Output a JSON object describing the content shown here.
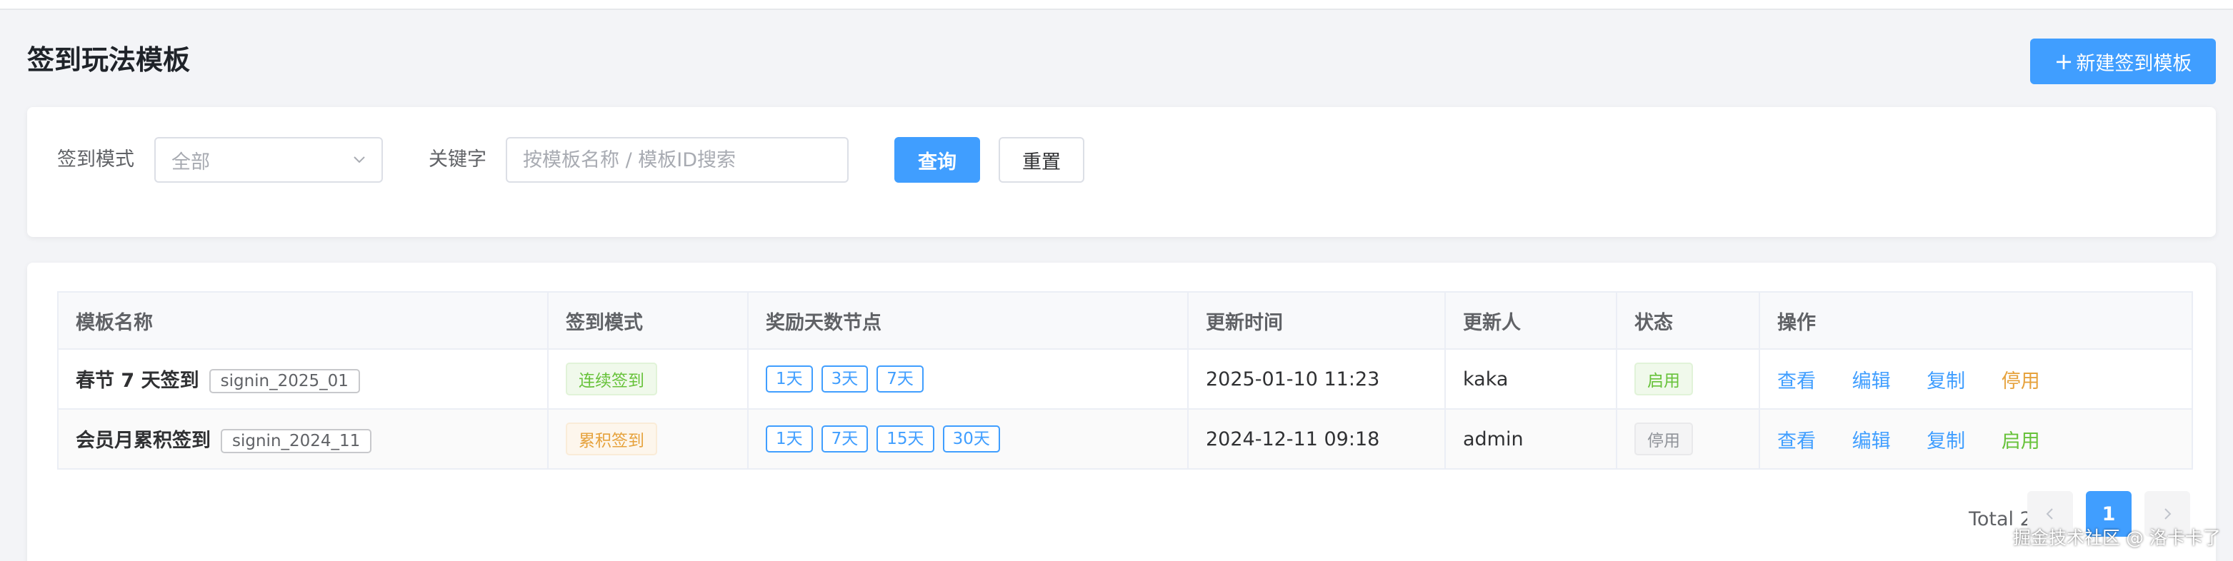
{
  "page": {
    "title": "签到玩法模板",
    "new_button": "新建签到模板",
    "new_button_plus": "+"
  },
  "filter": {
    "mode_label": "签到模式",
    "mode_value": "全部",
    "keyword_label": "关键字",
    "keyword_placeholder": "按模板名称 / 模板ID搜索",
    "query_button": "查询",
    "reset_button": "重置"
  },
  "table": {
    "headers": [
      "模板名称",
      "签到模式",
      "奖励天数节点",
      "更新时间",
      "更新人",
      "状态",
      "操作"
    ],
    "rows": [
      {
        "name": "春节 7 天签到",
        "code": "signin_2025_01",
        "mode": "连续签到",
        "days": [
          "1天",
          "3天",
          "7天"
        ],
        "updated_at": "2025-01-10 11:23",
        "updater": "kaka",
        "status": "启用",
        "actions": [
          "查看",
          "编辑",
          "复制",
          "停用"
        ]
      },
      {
        "name": "会员月累积签到",
        "code": "signin_2024_11",
        "mode": "累积签到",
        "days": [
          "1天",
          "7天",
          "15天",
          "30天"
        ],
        "updated_at": "2024-12-11 09:18",
        "updater": "admin",
        "status": "停用",
        "actions": [
          "查看",
          "编辑",
          "复制",
          "启用"
        ]
      }
    ]
  },
  "pagination": {
    "total_text": "Total 2",
    "current_page": "1",
    "prev_icon": "chevron-left-icon",
    "next_icon": "chevron-right-icon"
  },
  "watermark": "掘金技术社区 @ 洛卡卡了",
  "colors": {
    "primary": "#409eff",
    "success": "#67c23a",
    "warning": "#e6a23c",
    "info": "#909399",
    "background": "#f3f4f7"
  }
}
